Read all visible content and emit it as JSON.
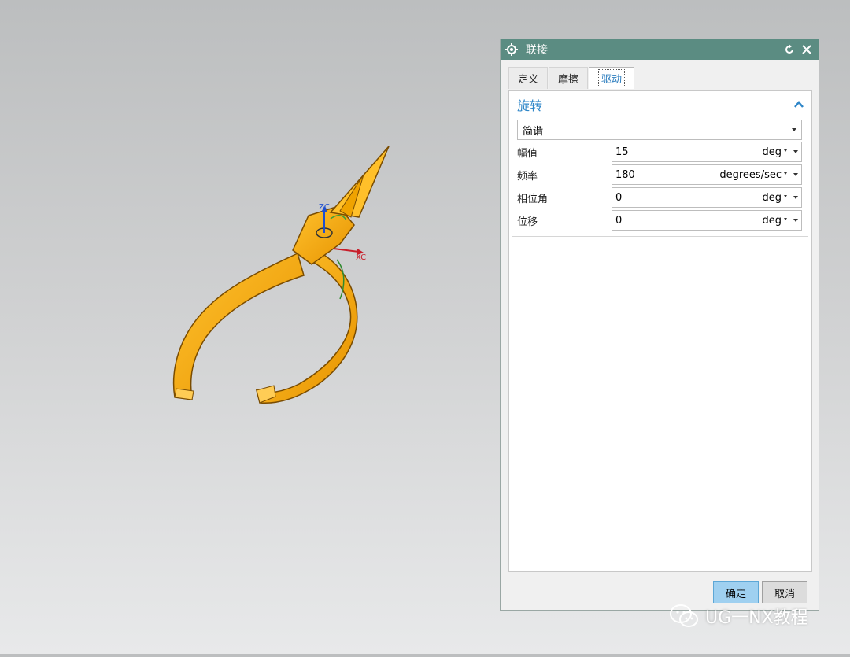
{
  "dialog": {
    "title": "联接",
    "tabs": [
      {
        "label": "定义"
      },
      {
        "label": "摩擦"
      },
      {
        "label": "驱动"
      }
    ],
    "active_tab": "驱动",
    "section_title": "旋转",
    "drive_type": "简谐",
    "params": [
      {
        "label": "幅值",
        "value": "15",
        "unit": "deg"
      },
      {
        "label": "频率",
        "value": "180",
        "unit": "degrees/sec"
      },
      {
        "label": "相位角",
        "value": "0",
        "unit": "deg"
      },
      {
        "label": "位移",
        "value": "0",
        "unit": "deg"
      }
    ],
    "ok_label": "确定",
    "cancel_label": "取消"
  },
  "viewport": {
    "axis_z": "ZC",
    "axis_x": "XC",
    "model_color": "#f5a60c"
  },
  "watermark": {
    "text": "UG一NX教程"
  }
}
